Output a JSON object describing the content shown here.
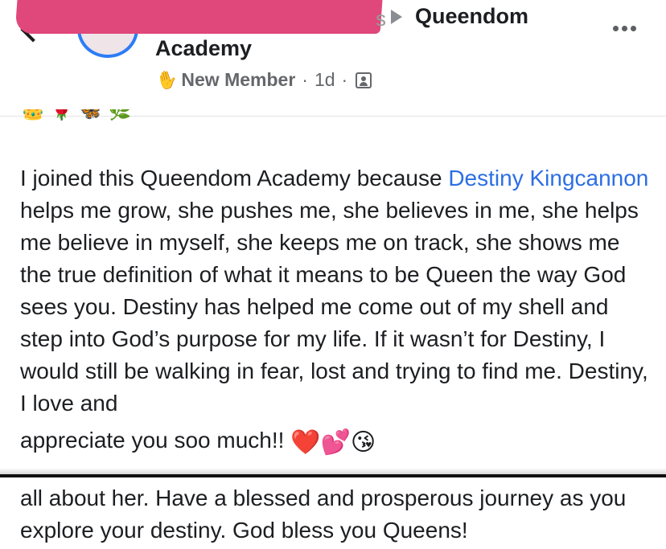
{
  "header": {
    "group_name_line1": "Queendom",
    "group_name_line2": "Academy",
    "member_badge": "New Member",
    "time": "1d",
    "separator": "·",
    "redaction_tail": "s"
  },
  "icons": {
    "back": "chevron-left-icon",
    "arrow": "triangle-right-icon",
    "more": "more-options-icon",
    "badge": "waving-hand-icon",
    "audience": "group-members-icon"
  },
  "emoji_strip": "👑🌹🦋🌿",
  "post": {
    "text_before_mention": "I joined this Queendom Academy because ",
    "mention": "Destiny Kingcannon",
    "text_after_mention": " helps me grow, she pushes me, she believes in me, she helps me believe in myself, she keeps me on track, she shows me the true definition of what it means to be Queen the way God sees you. Destiny has helped me come out of my shell and step into God’s purpose for my life. If it wasn’t for Destiny, I would still be walking in fear, lost and trying to find me. Destiny, I love and",
    "closing_text": "appreciate you soo much!! ",
    "closing_emojis": "❤️💕😘"
  },
  "second_post": {
    "text": "all about her. Have a blessed and prosperous journey as you explore your destiny. God bless you Queens!"
  },
  "colors": {
    "redaction": "#e0477a",
    "avatar_ring": "#2d7cf6",
    "mention_link": "#2c6ee5",
    "meta_text": "#65676b"
  }
}
